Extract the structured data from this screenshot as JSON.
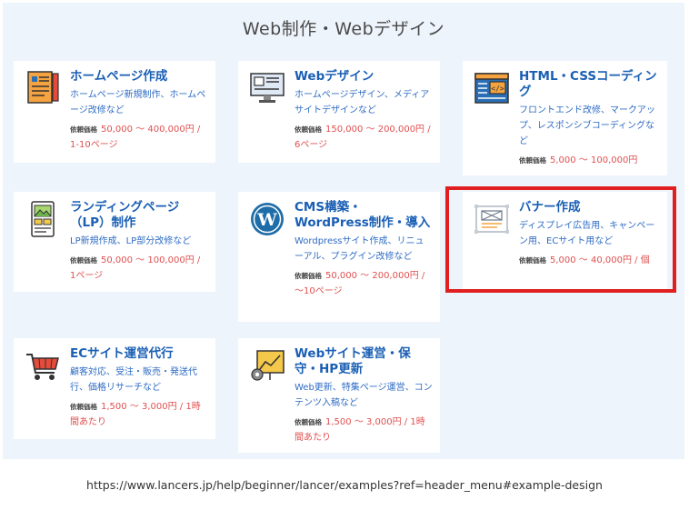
{
  "section": {
    "title": "Web制作・Webデザイン"
  },
  "price_label": "依頼価格",
  "cards": [
    {
      "title": "ホームページ作成",
      "desc": "ホームページ新規制作、ホームページ改修など",
      "price": "50,000 〜 400,000円 / 1-10ページ"
    },
    {
      "title": "Webデザイン",
      "desc": "ホームページデザイン、メディアサイトデザインなど",
      "price": "150,000 〜 200,000円 / 6ページ"
    },
    {
      "title": "HTML・CSSコーディング",
      "desc": "フロントエンド改修、マークアップ、レスポンシブコーディングなど",
      "price": "5,000 〜 100,000円"
    },
    {
      "title": "ランディングページ（LP）制作",
      "desc": "LP新規作成、LP部分改修など",
      "price": "50,000 〜 100,000円 / 1ページ"
    },
    {
      "title": "CMS構築・WordPress制作・導入",
      "desc": "Wordpressサイト作成、リニューアル、プラグイン改修など",
      "price": "50,000 〜 200,000円 / 〜10ページ"
    },
    {
      "title": "バナー作成",
      "desc": "ディスプレイ広告用、キャンペーン用、ECサイト用など",
      "price": "5,000 〜 40,000円 / 個"
    },
    {
      "title": "ECサイト運営代行",
      "desc": "顧客対応、受注・販売・発送代行、価格リサーチなど",
      "price": "1,500 〜 3,000円 / 1時間あたり"
    },
    {
      "title": "Webサイト運営・保守・HP更新",
      "desc": "Web更新、特集ページ運営、コンテンツ入稿など",
      "price": "1,500 〜 3,000円 / 1時間あたり"
    }
  ],
  "footer": {
    "url": "https://www.lancers.jp/help/beginner/lancer/examples?ref=header_menu#example-design"
  },
  "colors": {
    "title_blue": "#1a5fb4",
    "desc_blue": "#2f6cc4",
    "price_red": "#e05050",
    "highlight_red": "#e02020",
    "panel_bg": "#eef4fb"
  }
}
